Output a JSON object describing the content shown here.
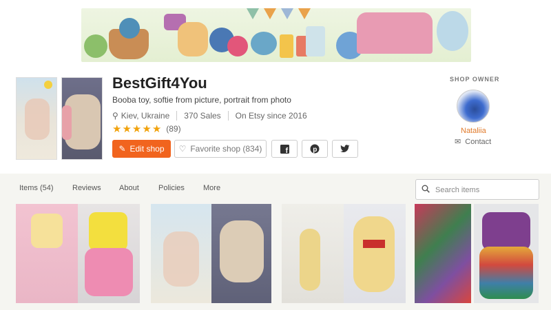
{
  "shop": {
    "name": "BestGift4You",
    "tagline": "Booba toy, softie from picture, portrait from photo",
    "location": "Kiev, Ukraine",
    "sales": "370 Sales",
    "since": "On Etsy since 2016",
    "rating_stars": 5,
    "reviews_count": "(89)"
  },
  "buttons": {
    "edit_shop": "Edit shop",
    "favorite_shop": "Favorite shop (834)"
  },
  "social": [
    "facebook-icon",
    "pinterest-icon",
    "twitter-icon"
  ],
  "owner": {
    "label": "SHOP OWNER",
    "name": "Nataliia",
    "contact": "Contact"
  },
  "nav": {
    "items": [
      "Items (54)",
      "Reviews",
      "About",
      "Policies",
      "More"
    ],
    "search_placeholder": "Search items"
  },
  "colors": {
    "accent": "#f1641e",
    "star": "#f1a20c",
    "owner_name": "#e07a2a",
    "nav_bg": "#f5f5f1"
  }
}
